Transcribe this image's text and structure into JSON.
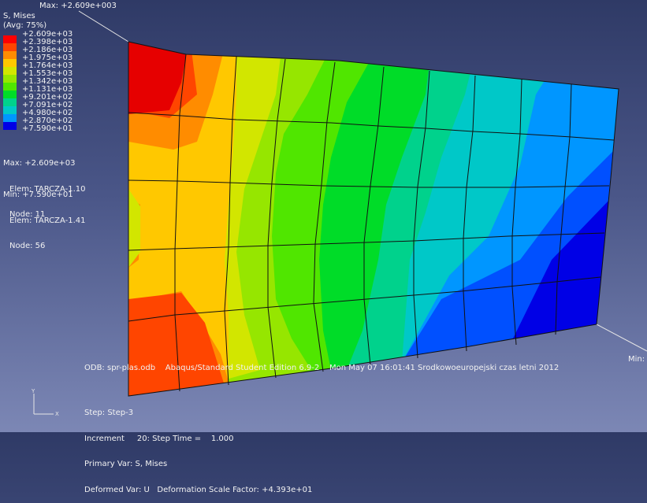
{
  "legend": {
    "title": "S, Mises",
    "avg": "(Avg: 75%)",
    "levels": [
      "+2.609e+03",
      "+2.398e+03",
      "+2.186e+03",
      "+1.975e+03",
      "+1.764e+03",
      "+1.553e+03",
      "+1.342e+03",
      "+1.131e+03",
      "+9.201e+02",
      "+7.091e+02",
      "+4.980e+02",
      "+2.870e+02",
      "+7.590e+01"
    ],
    "colors": [
      "#ff0000",
      "#ff4500",
      "#ff8c00",
      "#ffc800",
      "#d2e600",
      "#96e600",
      "#50e600",
      "#00dc28",
      "#00d28c",
      "#00c8c8",
      "#0096ff",
      "#0050ff",
      "#0000e6"
    ]
  },
  "max_info": {
    "line1": "Max: +2.609e+03",
    "elem": "Elem: TARCZA-1.10",
    "node": "Node: 11"
  },
  "min_info": {
    "line1": "Min: +7.590e+01",
    "elem": "Elem: TARCZA-1.41",
    "node": "Node: 56"
  },
  "max_label": "Max: +2.609e+003",
  "min_label": "Min:",
  "odb_line": "ODB: spr-plas.odb    Abaqus/Standard Student Edition 6.9-2    Mon May 07 16:01:41 Srodkowoeuropejski czas letni 2012",
  "step": {
    "step": "Step: Step-3",
    "increment": "Increment     20: Step Time =    1.000",
    "primary": "Primary Var: S, Mises",
    "deformed": "Deformed Var: U   Deformation Scale Factor: +4.393e+01"
  },
  "triad": {
    "y": "Y",
    "x": "X"
  }
}
